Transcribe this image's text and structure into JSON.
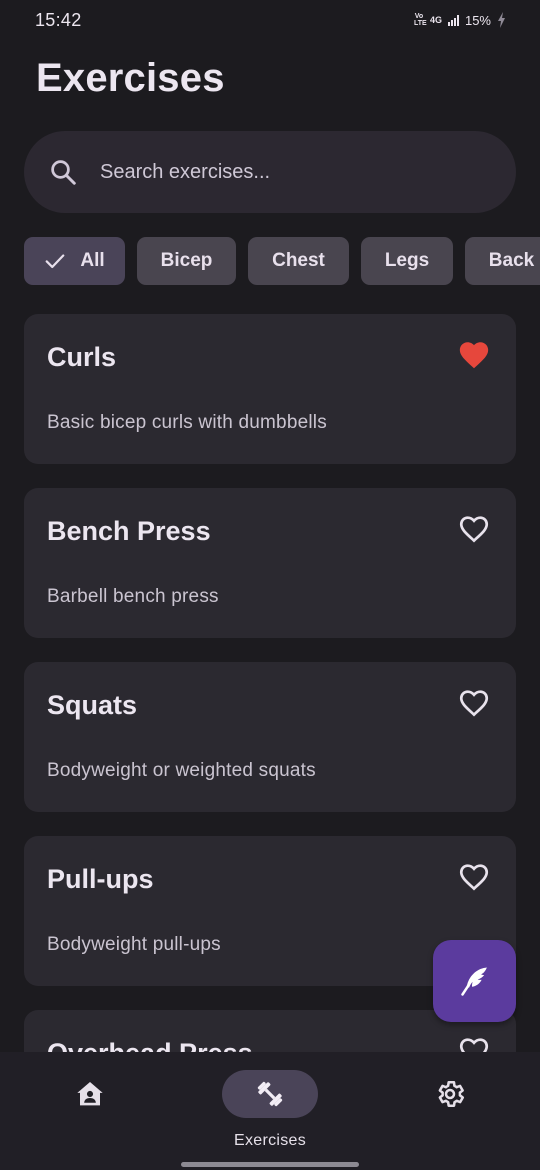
{
  "status_bar": {
    "time": "15:42",
    "volte_top": "Vo",
    "volte_bottom": "LTE",
    "network": "4G",
    "battery": "15%"
  },
  "page": {
    "title": "Exercises"
  },
  "search": {
    "placeholder": "Search exercises...",
    "icon": "search-icon"
  },
  "filters": {
    "selected": "All",
    "chips": [
      {
        "label": "All",
        "selected": true
      },
      {
        "label": "Bicep",
        "selected": false
      },
      {
        "label": "Chest",
        "selected": false
      },
      {
        "label": "Legs",
        "selected": false
      },
      {
        "label": "Back",
        "selected": false
      }
    ]
  },
  "exercises": [
    {
      "name": "Curls",
      "description": "Basic bicep curls with dumbbells",
      "favorite": true
    },
    {
      "name": "Bench Press",
      "description": "Barbell bench press",
      "favorite": false
    },
    {
      "name": "Squats",
      "description": "Bodyweight or weighted squats",
      "favorite": false
    },
    {
      "name": "Pull-ups",
      "description": "Bodyweight pull-ups",
      "favorite": false
    },
    {
      "name": "Overhead Press",
      "description": "",
      "favorite": false
    }
  ],
  "fab": {
    "icon": "quill-icon"
  },
  "bottom_nav": {
    "items": [
      {
        "id": "home",
        "icon": "home-icon",
        "label": "",
        "active": false
      },
      {
        "id": "exercises",
        "icon": "dumbbell-icon",
        "label": "Exercises",
        "active": true
      },
      {
        "id": "settings",
        "icon": "gear-icon",
        "label": "",
        "active": false
      }
    ]
  },
  "colors": {
    "background": "#1c1b1f",
    "card": "#2b2930",
    "chip": "#49454f",
    "favorite_active": "#e6473c",
    "fab": "#5b3b9e",
    "nav_active_pill": "#4a4458"
  }
}
